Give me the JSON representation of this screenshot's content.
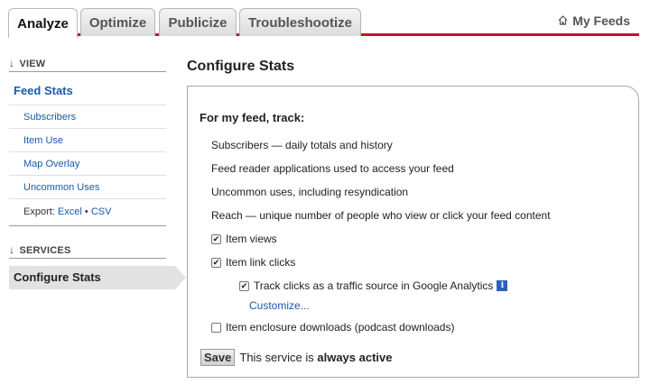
{
  "tabs": [
    {
      "label": "Analyze",
      "active": true
    },
    {
      "label": "Optimize",
      "active": false
    },
    {
      "label": "Publicize",
      "active": false
    },
    {
      "label": "Troubleshootize",
      "active": false
    }
  ],
  "my_feeds": {
    "label": "My Feeds",
    "icon": "home-icon"
  },
  "sidebar": {
    "view_heading": "VIEW",
    "arrow": "↓",
    "feed_stats": "Feed Stats",
    "items": [
      {
        "label": "Subscribers"
      },
      {
        "label": "Item Use"
      },
      {
        "label": "Map Overlay"
      },
      {
        "label": "Uncommon Uses"
      }
    ],
    "export": {
      "prefix": "Export:",
      "excel": "Excel",
      "separator": "•",
      "csv": "CSV"
    },
    "services_heading": "SERVICES",
    "active_service": "Configure Stats"
  },
  "main": {
    "title": "Configure Stats",
    "heading": "For my feed, track:",
    "lines": [
      "Subscribers — daily totals and history",
      "Feed reader applications used to access your feed",
      "Uncommon uses, including resyndication",
      "Reach — unique number of people who view or click your feed content"
    ],
    "checkboxes": {
      "item_views": {
        "label": "Item views",
        "checked": true
      },
      "item_link_clicks": {
        "label": "Item link clicks",
        "checked": true
      },
      "track_clicks": {
        "label": "Track clicks as a traffic source in Google Analytics",
        "checked": true
      },
      "enclosure": {
        "label": "Item enclosure downloads (podcast downloads)",
        "checked": false
      }
    },
    "info_glyph": "i",
    "customize": "Customize...",
    "save_label": "Save",
    "status_prefix": "This service is",
    "status_value": "always active"
  },
  "colors": {
    "accent_line": "#c8102e",
    "link": "#1a5aa8",
    "info_icon": "#2a62b8"
  }
}
